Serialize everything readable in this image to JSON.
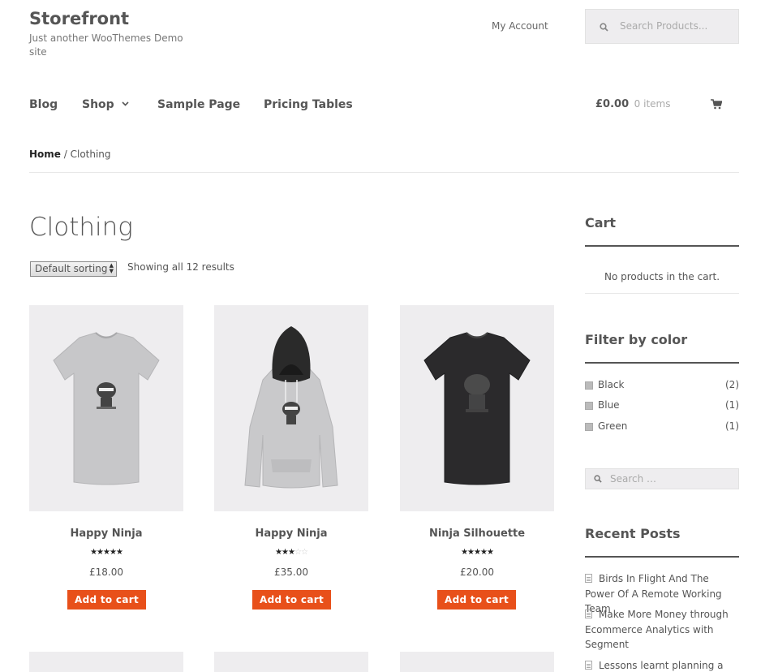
{
  "header": {
    "site_title": "Storefront",
    "site_description": "Just another WooThemes Demo site",
    "my_account": "My Account",
    "search_placeholder": "Search Products..."
  },
  "nav": {
    "items": [
      "Blog",
      "Shop",
      "Sample Page",
      "Pricing Tables"
    ],
    "cart_total": "£0.00",
    "cart_count": "0 items"
  },
  "breadcrumb": {
    "home": "Home",
    "separator": " / ",
    "current": "Clothing"
  },
  "main": {
    "title": "Clothing",
    "sort_selected": "Default sorting",
    "result_count": "Showing all 12 results",
    "products": [
      {
        "title": "Happy Ninja",
        "price": "£18.00",
        "rating": 5,
        "button": "Add to cart",
        "image": "grey-ninja-tshirt"
      },
      {
        "title": "Happy Ninja",
        "price": "£35.00",
        "rating": 3,
        "button": "Add to cart",
        "image": "grey-ninja-hoodie"
      },
      {
        "title": "Ninja Silhouette",
        "price": "£20.00",
        "rating": 5,
        "button": "Add to cart",
        "image": "black-ninja-tshirt"
      }
    ]
  },
  "sidebar": {
    "cart_title": "Cart",
    "cart_empty": "No products in the cart.",
    "filter_title": "Filter by color",
    "colors": [
      {
        "name": "Black",
        "count": "(2)"
      },
      {
        "name": "Blue",
        "count": "(1)"
      },
      {
        "name": "Green",
        "count": "(1)"
      }
    ],
    "search_placeholder": "Search …",
    "recent_title": "Recent Posts",
    "posts": [
      "Birds In Flight And The Power Of A Remote Working Team",
      "Make More Money through Ecommerce Analytics with Segment",
      "Lessons learnt planning a big"
    ]
  },
  "colors": {
    "accent": "#e8501a",
    "text": "#555555",
    "panel": "#eeedef"
  }
}
